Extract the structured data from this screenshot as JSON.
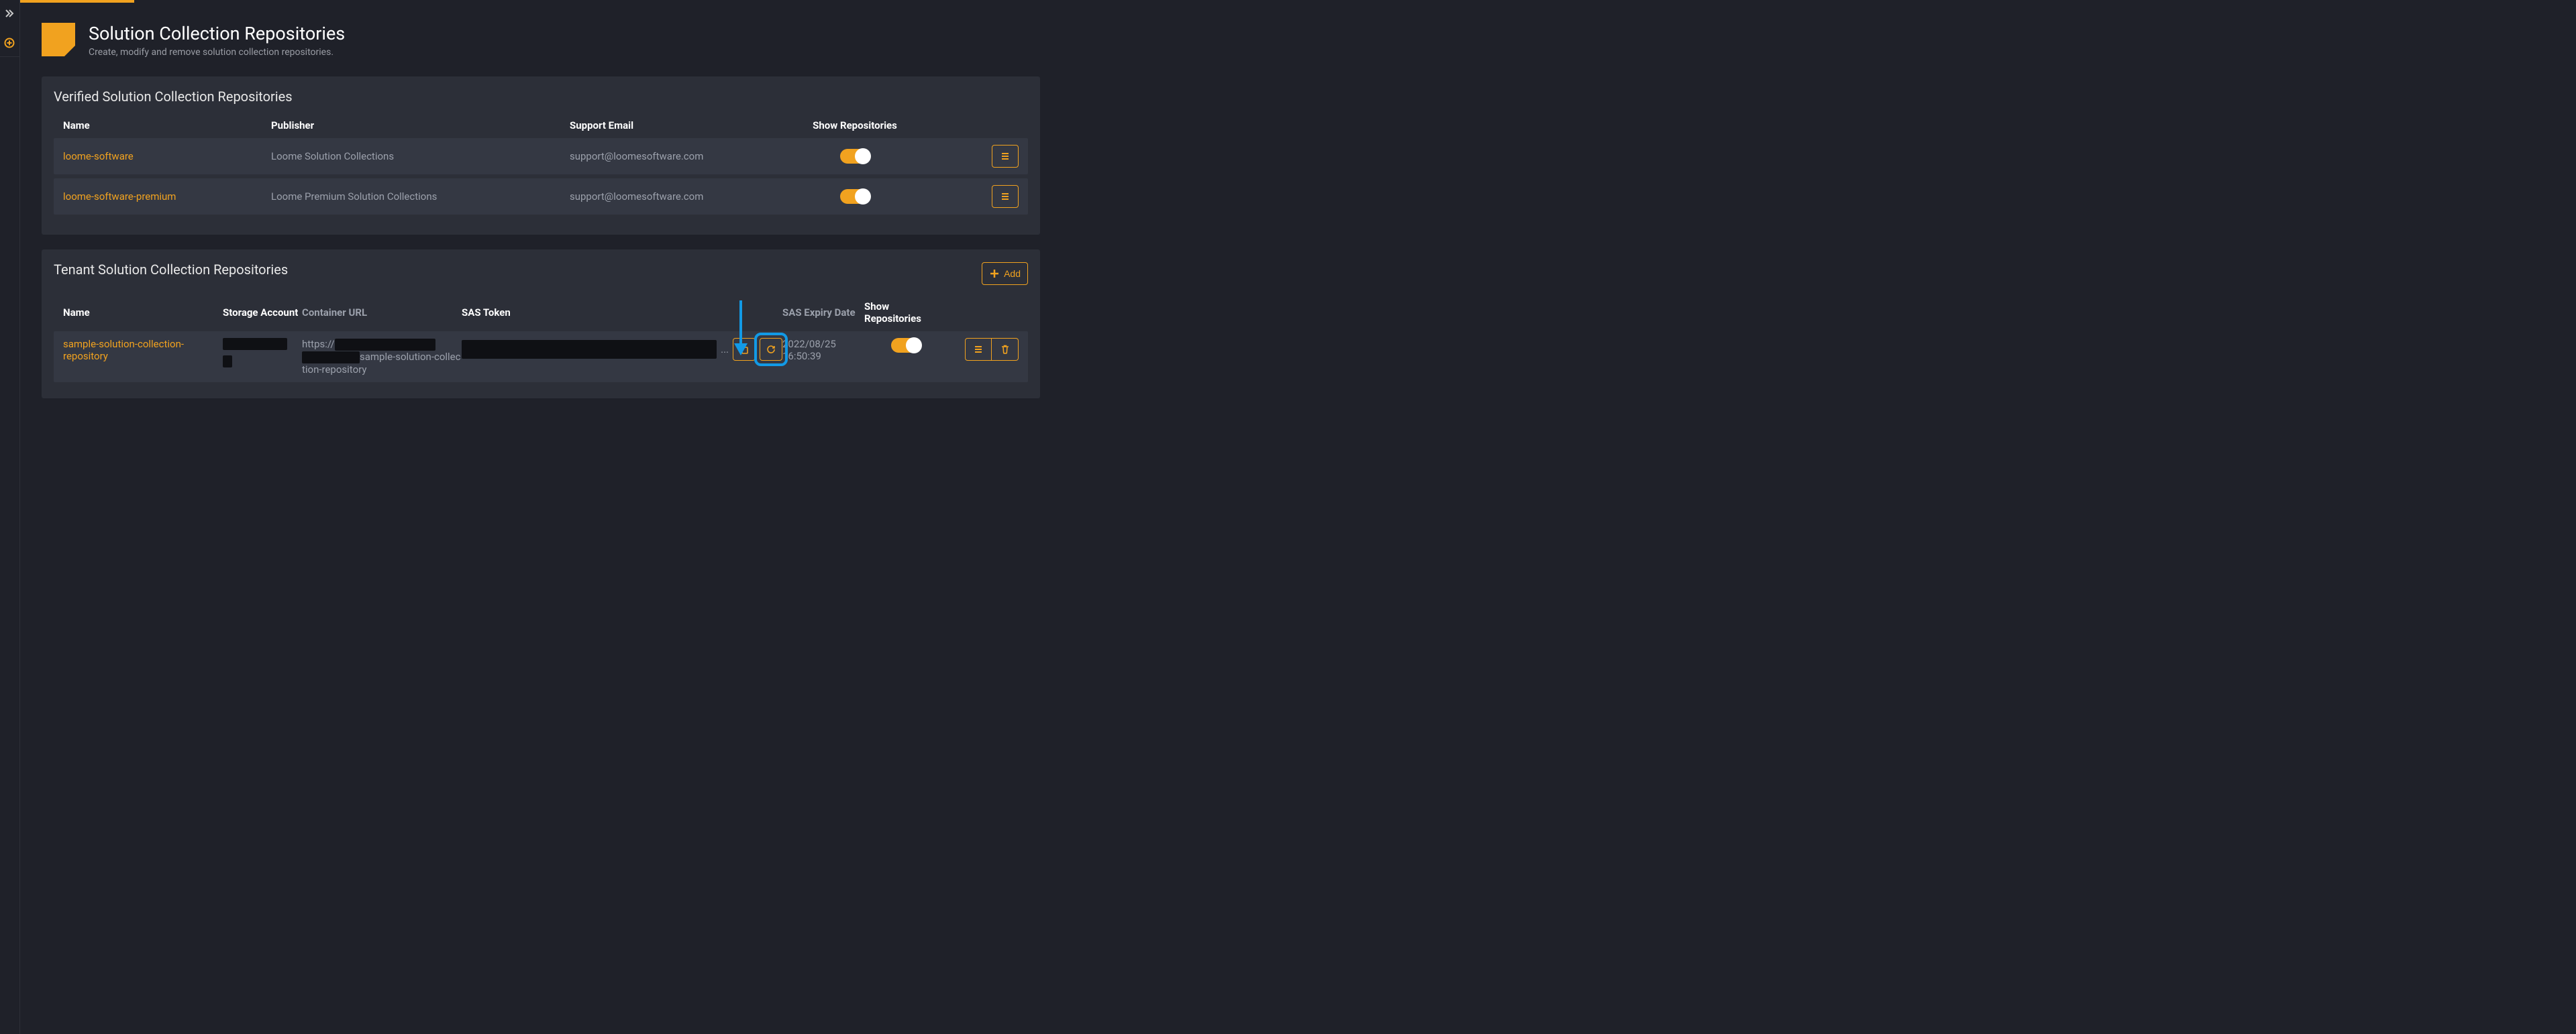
{
  "header": {
    "title": "Solution Collection Repositories",
    "subtitle": "Create, modify and remove solution collection repositories."
  },
  "verified": {
    "heading": "Verified Solution Collection Repositories",
    "columns": {
      "name": "Name",
      "publisher": "Publisher",
      "email": "Support Email",
      "show": "Show Repositories"
    },
    "rows": [
      {
        "name": "loome-software",
        "publisher": "Loome Solution Collections",
        "email": "support@loomesoftware.com",
        "show": true
      },
      {
        "name": "loome-software-premium",
        "publisher": "Loome Premium Solution Collections",
        "email": "support@loomesoftware.com",
        "show": true
      }
    ]
  },
  "tenant": {
    "heading": "Tenant Solution Collection Repositories",
    "add_label": "Add",
    "columns": {
      "name": "Name",
      "storage": "Storage Account",
      "url": "Container URL",
      "sas": "SAS Token",
      "expiry": "SAS Expiry Date",
      "show": "Show Repositories"
    },
    "rows": [
      {
        "name": "sample-solution-collection-repository",
        "url_prefix": "https://",
        "url_suffix": "sample-solution-collection-repository",
        "sas_ellipsis": "...",
        "expiry_date": "2022/08/25",
        "expiry_time": "16:50:39",
        "show": true
      }
    ]
  },
  "colors": {
    "accent": "#f1a21f",
    "annotation": "#129ae6"
  }
}
